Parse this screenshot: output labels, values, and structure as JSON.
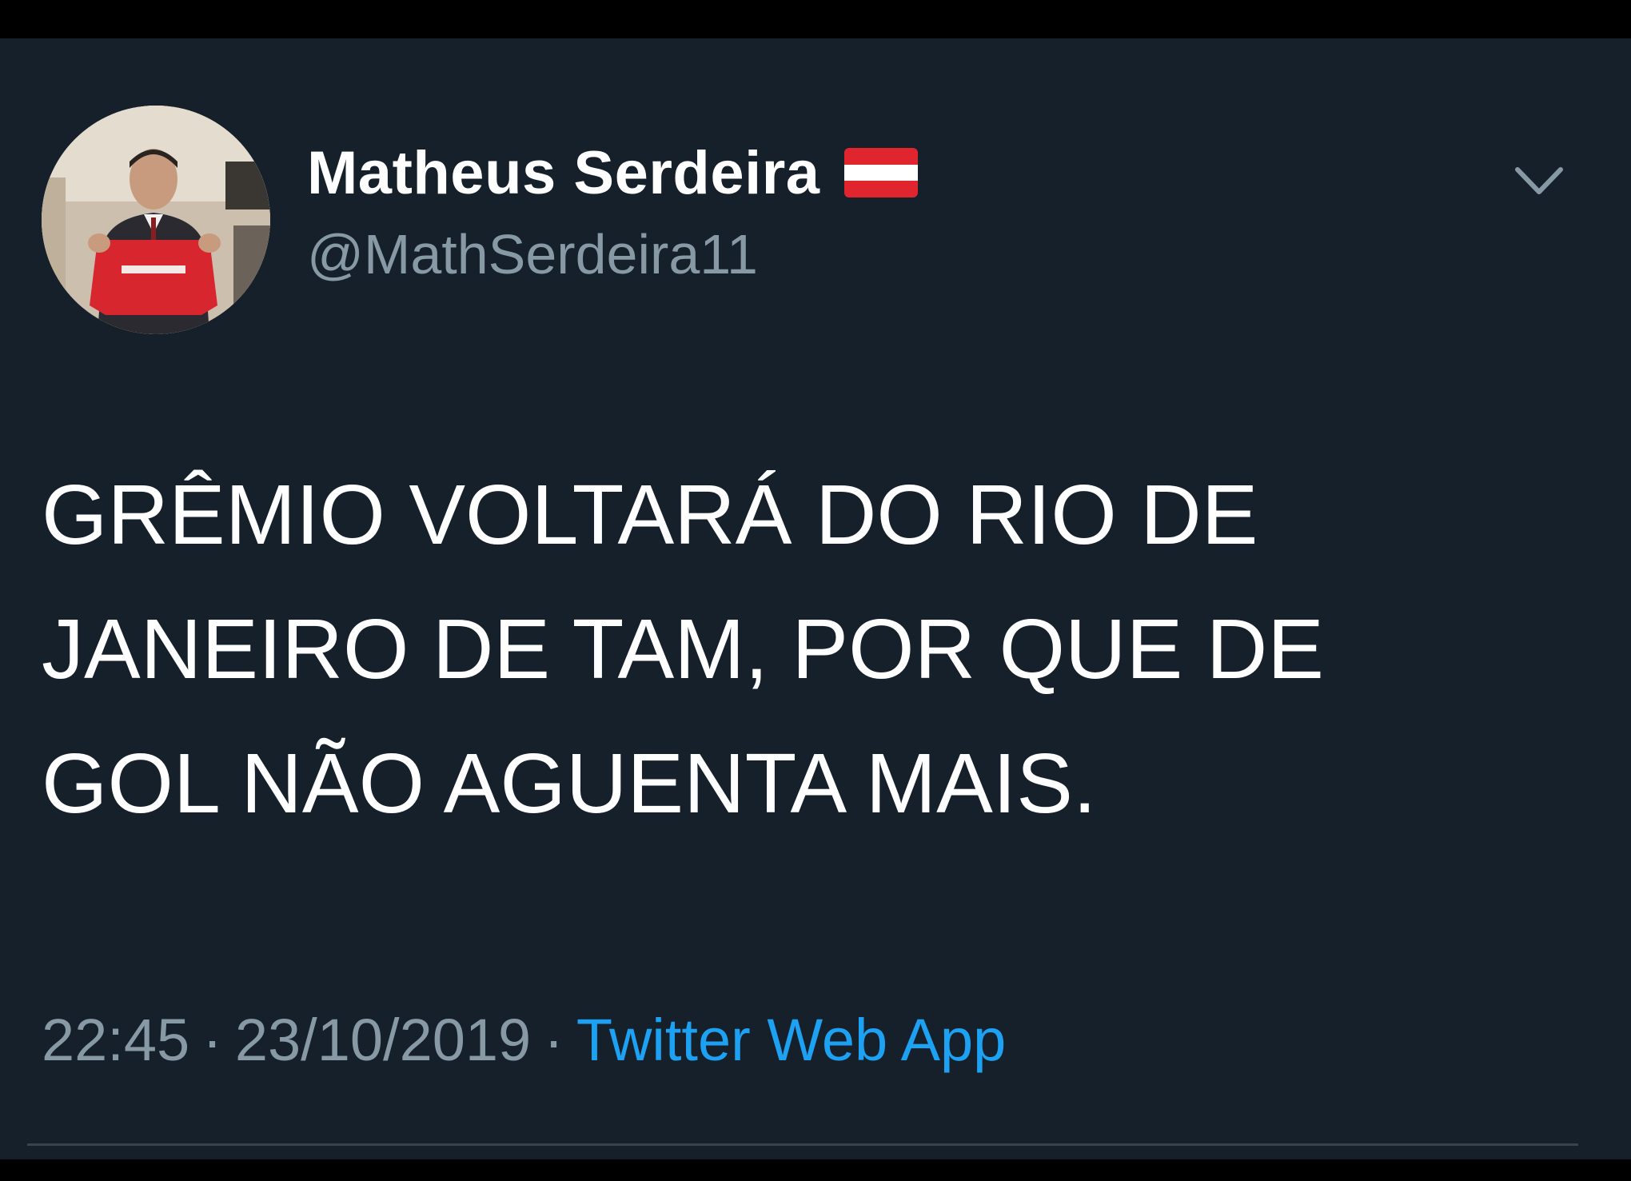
{
  "tweet": {
    "display_name": "Matheus Serdeira",
    "handle": "@MathSerdeira11",
    "text": "GRÊMIO VOLTARÁ DO RIO DE\nJANEIRO DE TAM, POR QUE DE\nGOL NÃO AGUENTA MAIS.",
    "time": "22:45",
    "separator": "·",
    "date": "23/10/2019",
    "source": "Twitter Web App"
  },
  "icons": {
    "flag": "flag-icon",
    "menu": "chevron-down-icon",
    "avatar": "avatar"
  },
  "colors": {
    "background": "#15202b",
    "frame": "#000000",
    "text_primary": "#ffffff",
    "text_secondary": "#8899a6",
    "link": "#1da1f2",
    "divider": "#38444d",
    "flag_red": "#e0252e",
    "flag_white": "#ffffff"
  }
}
